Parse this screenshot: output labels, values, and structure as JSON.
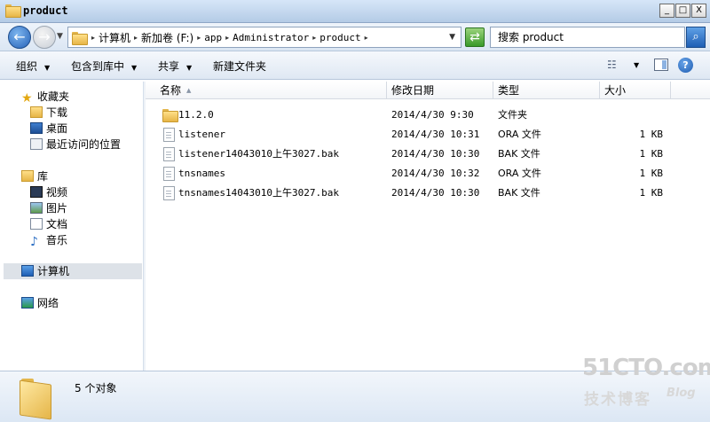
{
  "window": {
    "title": "product",
    "min": "_",
    "max": "□",
    "close": "X"
  },
  "address": {
    "crumbs": [
      "计算机",
      "新加卷 (F:)",
      "app",
      "Administrator",
      "product"
    ],
    "search_placeholder": "搜索 product"
  },
  "toolbar": {
    "organize": "组织",
    "include_in_library": "包含到库中",
    "share": "共享",
    "new_folder": "新建文件夹"
  },
  "sidebar": {
    "favorites": "收藏夹",
    "downloads": "下载",
    "desktop": "桌面",
    "recent": "最近访问的位置",
    "libraries": "库",
    "videos": "视频",
    "pictures": "图片",
    "documents": "文档",
    "music": "音乐",
    "computer": "计算机",
    "network": "网络"
  },
  "columns": {
    "name": "名称",
    "date": "修改日期",
    "type": "类型",
    "size": "大小"
  },
  "files": [
    {
      "name": "11.2.0",
      "date": "2014/4/30 9:30",
      "type": "文件夹",
      "size": "",
      "kind": "folder"
    },
    {
      "name": "listener",
      "date": "2014/4/30 10:31",
      "type": "ORA 文件",
      "size": "1 KB",
      "kind": "file"
    },
    {
      "name": "listener14043010上午3027.bak",
      "date": "2014/4/30 10:30",
      "type": "BAK 文件",
      "size": "1 KB",
      "kind": "file"
    },
    {
      "name": "tnsnames",
      "date": "2014/4/30 10:32",
      "type": "ORA 文件",
      "size": "1 KB",
      "kind": "file"
    },
    {
      "name": "tnsnames14043010上午3027.bak",
      "date": "2014/4/30 10:30",
      "type": "BAK 文件",
      "size": "1 KB",
      "kind": "file"
    }
  ],
  "status": {
    "count_text": "5 个对象"
  },
  "watermark": {
    "line1": "51CTO.com",
    "line2": "技术博客",
    "line3": "Blog"
  }
}
